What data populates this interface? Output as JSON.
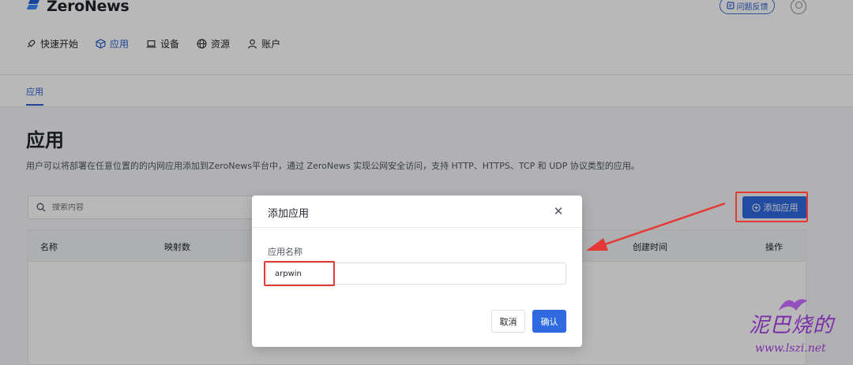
{
  "brand": {
    "name": "ZeroNews"
  },
  "header": {
    "feedback_label": "问题反馈"
  },
  "nav": [
    {
      "label": "快速开始",
      "icon": "rocket-icon"
    },
    {
      "label": "应用",
      "icon": "cube-icon"
    },
    {
      "label": "设备",
      "icon": "laptop-icon"
    },
    {
      "label": "资源",
      "icon": "globe-icon"
    },
    {
      "label": "账户",
      "icon": "user-icon"
    }
  ],
  "nav_active": "应用",
  "subtabs": [
    {
      "label": "应用"
    }
  ],
  "page": {
    "title": "应用",
    "description": "用户可以将部署在任意位置的的内网应用添加到ZeroNews平台中，通过 ZeroNews 实现公网安全访问，支持 HTTP、HTTPS、TCP 和 UDP 协议类型的应用。"
  },
  "search": {
    "placeholder": "搜索内容"
  },
  "toolbar": {
    "add_label": "添加应用"
  },
  "table": {
    "columns": [
      "名称",
      "映射数",
      "创建时间",
      "操作"
    ]
  },
  "modal": {
    "title": "添加应用",
    "field_label": "应用名称",
    "field_value": "arpwin",
    "cancel_label": "取消",
    "confirm_label": "确认"
  },
  "watermark": {
    "text": "泥巴烧的",
    "url": "www.lszi.net"
  },
  "colors": {
    "accent": "#2f6ae0",
    "annotation": "#e53935",
    "watermark": "#7b2ca8"
  }
}
